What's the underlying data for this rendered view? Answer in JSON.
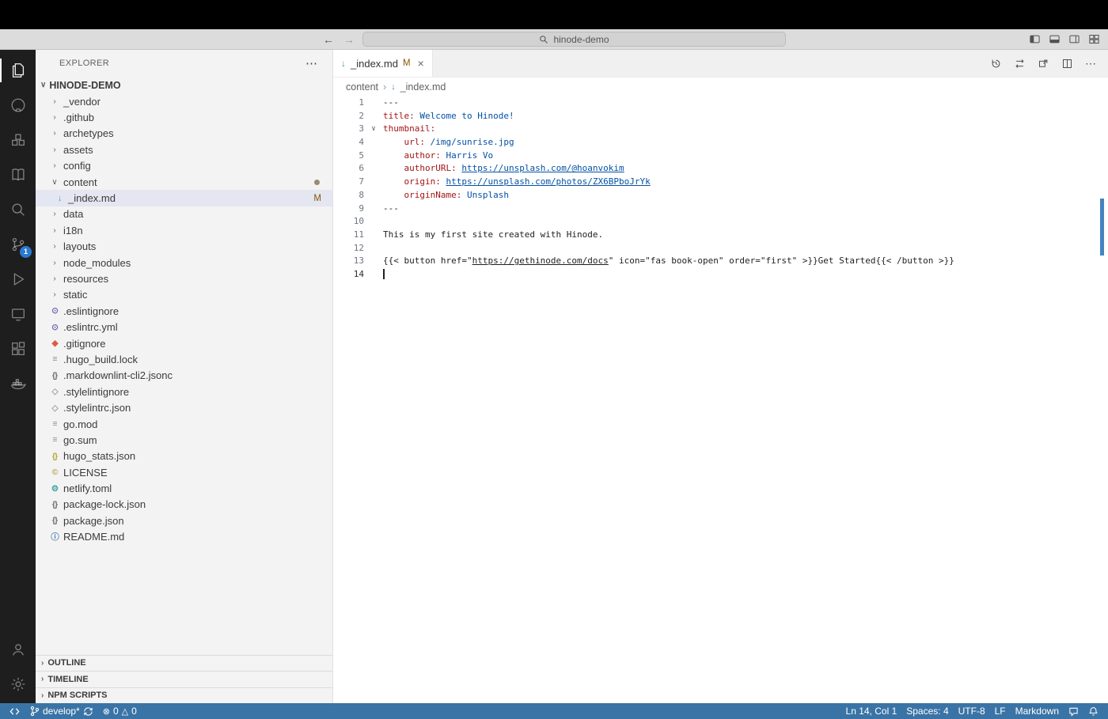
{
  "colors": {
    "status_bar_bg": "#3a74a6",
    "badge_bg": "#2a7ad2",
    "yaml_key": "#a31515",
    "yaml_value": "#0451a5",
    "modified_gold": "#895503",
    "selection_bg": "#e4e6f1"
  },
  "titlebar": {
    "search_value": "hinode-demo",
    "back": "←",
    "forward": "→"
  },
  "activity_bar": {
    "source_control_badge": "1",
    "items": [
      "explorer",
      "github",
      "cubes",
      "book",
      "search",
      "source-control",
      "run-debug",
      "remote-explorer",
      "extensions",
      "docker"
    ],
    "bottom_items": [
      "account",
      "settings"
    ]
  },
  "sidebar": {
    "header": "EXPLORER",
    "more_label": "⋯",
    "root": {
      "label": "HINODE-DEMO"
    },
    "items": [
      {
        "label": "_vendor",
        "type": "folder"
      },
      {
        "label": ".github",
        "type": "folder"
      },
      {
        "label": "archetypes",
        "type": "folder"
      },
      {
        "label": "assets",
        "type": "folder"
      },
      {
        "label": "config",
        "type": "folder"
      },
      {
        "label": "content",
        "type": "folder",
        "expanded": true,
        "badge": "dot"
      },
      {
        "label": "_index.md",
        "type": "file",
        "icon": "markdown",
        "level": 2,
        "selected": true,
        "badge": "M"
      },
      {
        "label": "data",
        "type": "folder"
      },
      {
        "label": "i18n",
        "type": "folder"
      },
      {
        "label": "layouts",
        "type": "folder"
      },
      {
        "label": "node_modules",
        "type": "folder"
      },
      {
        "label": "resources",
        "type": "folder"
      },
      {
        "label": "static",
        "type": "folder"
      },
      {
        "label": ".eslintignore",
        "type": "file",
        "icon": "eslint"
      },
      {
        "label": ".eslintrc.yml",
        "type": "file",
        "icon": "eslint"
      },
      {
        "label": ".gitignore",
        "type": "file",
        "icon": "git"
      },
      {
        "label": ".hugo_build.lock",
        "type": "file",
        "icon": "doc"
      },
      {
        "label": ".markdownlint-cli2.jsonc",
        "type": "file",
        "icon": "braces"
      },
      {
        "label": ".stylelintignore",
        "type": "file",
        "icon": "stylelint"
      },
      {
        "label": ".stylelintrc.json",
        "type": "file",
        "icon": "stylelint"
      },
      {
        "label": "go.mod",
        "type": "file",
        "icon": "doc"
      },
      {
        "label": "go.sum",
        "type": "file",
        "icon": "doc"
      },
      {
        "label": "hugo_stats.json",
        "type": "file",
        "icon": "braces-yellow"
      },
      {
        "label": "LICENSE",
        "type": "file",
        "icon": "license"
      },
      {
        "label": "netlify.toml",
        "type": "file",
        "icon": "gear-teal"
      },
      {
        "label": "package-lock.json",
        "type": "file",
        "icon": "braces"
      },
      {
        "label": "package.json",
        "type": "file",
        "icon": "braces"
      },
      {
        "label": "README.md",
        "type": "file",
        "icon": "info"
      }
    ],
    "bottom_sections": [
      "OUTLINE",
      "TIMELINE",
      "NPM SCRIPTS"
    ]
  },
  "icon_glyphs": {
    "folder-collapsed": "›",
    "folder-expanded": "∨",
    "markdown": "↓",
    "eslint": "⊙",
    "git": "◆",
    "doc": "≡",
    "braces": "{}",
    "braces-yellow": "{}",
    "stylelint": "◇",
    "license": "©",
    "gear-teal": "⚙",
    "info": "ⓘ"
  },
  "icon_colors": {
    "markdown": "#4a8fb8",
    "eslint": "#7b68ae",
    "git": "#e0593f",
    "doc": "#8a8a8a",
    "braces": "#6d6d6d",
    "braces-yellow": "#b7a73b",
    "stylelint": "#9aa2a8",
    "license": "#b5a24b",
    "gear-teal": "#3fa6a6",
    "info": "#4a7fae"
  },
  "editor": {
    "tab": {
      "label": "_index.md",
      "git_status": "M",
      "close": "×"
    },
    "breadcrumbs": {
      "folder": "content",
      "separator": "›",
      "file": "_index.md"
    },
    "code": {
      "lines": [
        {
          "n": 1,
          "tokens": [
            {
              "t": "---",
              "c": "plain"
            }
          ]
        },
        {
          "n": 2,
          "tokens": [
            {
              "t": "title:",
              "c": "key"
            },
            {
              "t": " ",
              "c": "plain"
            },
            {
              "t": "Welcome to Hinode!",
              "c": "value"
            }
          ]
        },
        {
          "n": 3,
          "fold": true,
          "tokens": [
            {
              "t": "thumbnail:",
              "c": "key"
            }
          ]
        },
        {
          "n": 4,
          "tokens": [
            {
              "t": "    ",
              "c": "plain"
            },
            {
              "t": "url:",
              "c": "key"
            },
            {
              "t": " ",
              "c": "plain"
            },
            {
              "t": "/img/sunrise.jpg",
              "c": "value"
            }
          ]
        },
        {
          "n": 5,
          "tokens": [
            {
              "t": "    ",
              "c": "plain"
            },
            {
              "t": "author:",
              "c": "key"
            },
            {
              "t": " ",
              "c": "plain"
            },
            {
              "t": "Harris Vo",
              "c": "value"
            }
          ]
        },
        {
          "n": 6,
          "tokens": [
            {
              "t": "    ",
              "c": "plain"
            },
            {
              "t": "authorURL:",
              "c": "key"
            },
            {
              "t": " ",
              "c": "plain"
            },
            {
              "t": "https://unsplash.com/@hoanvokim",
              "c": "link"
            }
          ]
        },
        {
          "n": 7,
          "tokens": [
            {
              "t": "    ",
              "c": "plain"
            },
            {
              "t": "origin:",
              "c": "key"
            },
            {
              "t": " ",
              "c": "plain"
            },
            {
              "t": "https://unsplash.com/photos/ZX6BPboJrYk",
              "c": "link"
            }
          ]
        },
        {
          "n": 8,
          "tokens": [
            {
              "t": "    ",
              "c": "plain"
            },
            {
              "t": "originName:",
              "c": "key"
            },
            {
              "t": " ",
              "c": "plain"
            },
            {
              "t": "Unsplash",
              "c": "value"
            }
          ]
        },
        {
          "n": 9,
          "tokens": [
            {
              "t": "---",
              "c": "plain"
            }
          ]
        },
        {
          "n": 10,
          "tokens": []
        },
        {
          "n": 11,
          "tokens": [
            {
              "t": "This is my first site created with Hinode.",
              "c": "plain"
            }
          ]
        },
        {
          "n": 12,
          "tokens": []
        },
        {
          "n": 13,
          "tokens": [
            {
              "t": "{{< button href=\"",
              "c": "plain"
            },
            {
              "t": "https://gethinode.com/docs",
              "c": "plainlink"
            },
            {
              "t": "\" icon=\"fas book-open\" order=\"first\" >}}Get Started{{< /button >}}",
              "c": "plain"
            }
          ]
        },
        {
          "n": 14,
          "cursor": true,
          "active": true,
          "tokens": []
        }
      ]
    }
  },
  "status_bar": {
    "branch": "develop*",
    "error_icon": "⊗",
    "errors": "0",
    "warning_icon": "△",
    "warnings": "0",
    "line_col": "Ln 14, Col 1",
    "indentation": "Spaces: 4",
    "encoding": "UTF-8",
    "eol": "LF",
    "language": "Markdown"
  }
}
